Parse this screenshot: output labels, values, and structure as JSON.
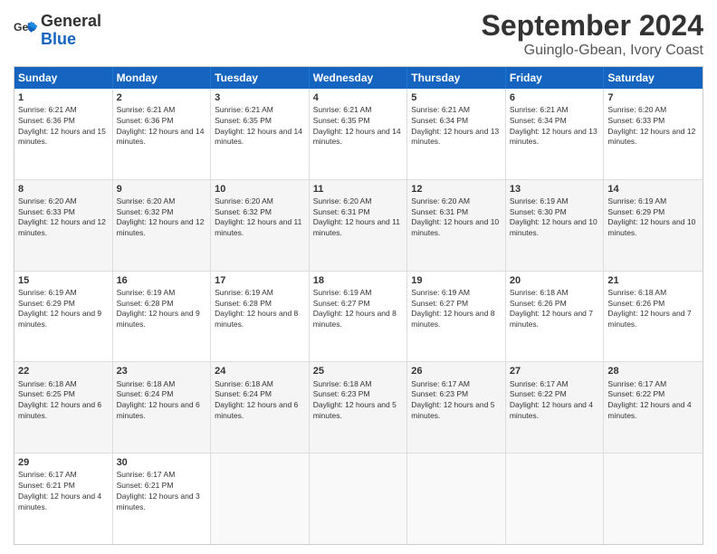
{
  "header": {
    "logo_line1": "General",
    "logo_line2": "Blue",
    "title": "September 2024",
    "subtitle": "Guinglo-Gbean, Ivory Coast"
  },
  "weekdays": [
    "Sunday",
    "Monday",
    "Tuesday",
    "Wednesday",
    "Thursday",
    "Friday",
    "Saturday"
  ],
  "rows": [
    [
      {
        "day": "1",
        "sunrise": "Sunrise: 6:21 AM",
        "sunset": "Sunset: 6:36 PM",
        "daylight": "Daylight: 12 hours and 15 minutes."
      },
      {
        "day": "2",
        "sunrise": "Sunrise: 6:21 AM",
        "sunset": "Sunset: 6:36 PM",
        "daylight": "Daylight: 12 hours and 14 minutes."
      },
      {
        "day": "3",
        "sunrise": "Sunrise: 6:21 AM",
        "sunset": "Sunset: 6:35 PM",
        "daylight": "Daylight: 12 hours and 14 minutes."
      },
      {
        "day": "4",
        "sunrise": "Sunrise: 6:21 AM",
        "sunset": "Sunset: 6:35 PM",
        "daylight": "Daylight: 12 hours and 14 minutes."
      },
      {
        "day": "5",
        "sunrise": "Sunrise: 6:21 AM",
        "sunset": "Sunset: 6:34 PM",
        "daylight": "Daylight: 12 hours and 13 minutes."
      },
      {
        "day": "6",
        "sunrise": "Sunrise: 6:21 AM",
        "sunset": "Sunset: 6:34 PM",
        "daylight": "Daylight: 12 hours and 13 minutes."
      },
      {
        "day": "7",
        "sunrise": "Sunrise: 6:20 AM",
        "sunset": "Sunset: 6:33 PM",
        "daylight": "Daylight: 12 hours and 12 minutes."
      }
    ],
    [
      {
        "day": "8",
        "sunrise": "Sunrise: 6:20 AM",
        "sunset": "Sunset: 6:33 PM",
        "daylight": "Daylight: 12 hours and 12 minutes."
      },
      {
        "day": "9",
        "sunrise": "Sunrise: 6:20 AM",
        "sunset": "Sunset: 6:32 PM",
        "daylight": "Daylight: 12 hours and 12 minutes."
      },
      {
        "day": "10",
        "sunrise": "Sunrise: 6:20 AM",
        "sunset": "Sunset: 6:32 PM",
        "daylight": "Daylight: 12 hours and 11 minutes."
      },
      {
        "day": "11",
        "sunrise": "Sunrise: 6:20 AM",
        "sunset": "Sunset: 6:31 PM",
        "daylight": "Daylight: 12 hours and 11 minutes."
      },
      {
        "day": "12",
        "sunrise": "Sunrise: 6:20 AM",
        "sunset": "Sunset: 6:31 PM",
        "daylight": "Daylight: 12 hours and 10 minutes."
      },
      {
        "day": "13",
        "sunrise": "Sunrise: 6:19 AM",
        "sunset": "Sunset: 6:30 PM",
        "daylight": "Daylight: 12 hours and 10 minutes."
      },
      {
        "day": "14",
        "sunrise": "Sunrise: 6:19 AM",
        "sunset": "Sunset: 6:29 PM",
        "daylight": "Daylight: 12 hours and 10 minutes."
      }
    ],
    [
      {
        "day": "15",
        "sunrise": "Sunrise: 6:19 AM",
        "sunset": "Sunset: 6:29 PM",
        "daylight": "Daylight: 12 hours and 9 minutes."
      },
      {
        "day": "16",
        "sunrise": "Sunrise: 6:19 AM",
        "sunset": "Sunset: 6:28 PM",
        "daylight": "Daylight: 12 hours and 9 minutes."
      },
      {
        "day": "17",
        "sunrise": "Sunrise: 6:19 AM",
        "sunset": "Sunset: 6:28 PM",
        "daylight": "Daylight: 12 hours and 8 minutes."
      },
      {
        "day": "18",
        "sunrise": "Sunrise: 6:19 AM",
        "sunset": "Sunset: 6:27 PM",
        "daylight": "Daylight: 12 hours and 8 minutes."
      },
      {
        "day": "19",
        "sunrise": "Sunrise: 6:19 AM",
        "sunset": "Sunset: 6:27 PM",
        "daylight": "Daylight: 12 hours and 8 minutes."
      },
      {
        "day": "20",
        "sunrise": "Sunrise: 6:18 AM",
        "sunset": "Sunset: 6:26 PM",
        "daylight": "Daylight: 12 hours and 7 minutes."
      },
      {
        "day": "21",
        "sunrise": "Sunrise: 6:18 AM",
        "sunset": "Sunset: 6:26 PM",
        "daylight": "Daylight: 12 hours and 7 minutes."
      }
    ],
    [
      {
        "day": "22",
        "sunrise": "Sunrise: 6:18 AM",
        "sunset": "Sunset: 6:25 PM",
        "daylight": "Daylight: 12 hours and 6 minutes."
      },
      {
        "day": "23",
        "sunrise": "Sunrise: 6:18 AM",
        "sunset": "Sunset: 6:24 PM",
        "daylight": "Daylight: 12 hours and 6 minutes."
      },
      {
        "day": "24",
        "sunrise": "Sunrise: 6:18 AM",
        "sunset": "Sunset: 6:24 PM",
        "daylight": "Daylight: 12 hours and 6 minutes."
      },
      {
        "day": "25",
        "sunrise": "Sunrise: 6:18 AM",
        "sunset": "Sunset: 6:23 PM",
        "daylight": "Daylight: 12 hours and 5 minutes."
      },
      {
        "day": "26",
        "sunrise": "Sunrise: 6:17 AM",
        "sunset": "Sunset: 6:23 PM",
        "daylight": "Daylight: 12 hours and 5 minutes."
      },
      {
        "day": "27",
        "sunrise": "Sunrise: 6:17 AM",
        "sunset": "Sunset: 6:22 PM",
        "daylight": "Daylight: 12 hours and 4 minutes."
      },
      {
        "day": "28",
        "sunrise": "Sunrise: 6:17 AM",
        "sunset": "Sunset: 6:22 PM",
        "daylight": "Daylight: 12 hours and 4 minutes."
      }
    ],
    [
      {
        "day": "29",
        "sunrise": "Sunrise: 6:17 AM",
        "sunset": "Sunset: 6:21 PM",
        "daylight": "Daylight: 12 hours and 4 minutes."
      },
      {
        "day": "30",
        "sunrise": "Sunrise: 6:17 AM",
        "sunset": "Sunset: 6:21 PM",
        "daylight": "Daylight: 12 hours and 3 minutes."
      },
      {
        "day": "",
        "sunrise": "",
        "sunset": "",
        "daylight": ""
      },
      {
        "day": "",
        "sunrise": "",
        "sunset": "",
        "daylight": ""
      },
      {
        "day": "",
        "sunrise": "",
        "sunset": "",
        "daylight": ""
      },
      {
        "day": "",
        "sunrise": "",
        "sunset": "",
        "daylight": ""
      },
      {
        "day": "",
        "sunrise": "",
        "sunset": "",
        "daylight": ""
      }
    ]
  ]
}
